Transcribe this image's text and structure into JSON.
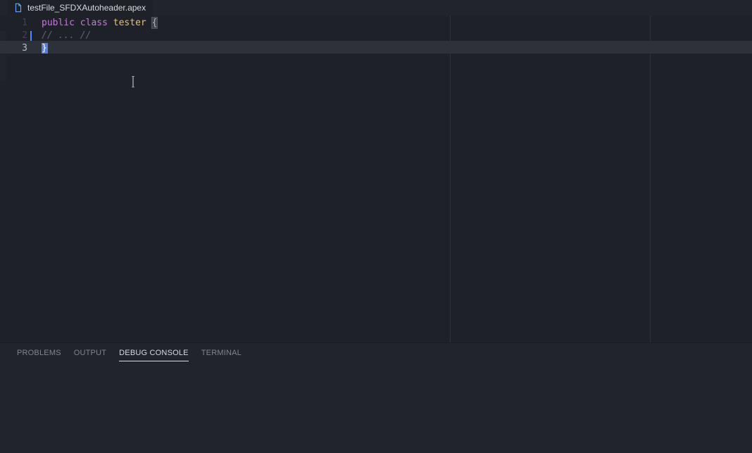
{
  "tab": {
    "filename": "testFile_SFDXAutoheader.apex"
  },
  "editor": {
    "line_numbers": [
      "1",
      "2",
      "3"
    ],
    "code": {
      "line1": {
        "kw1": "public",
        "kw2": "class",
        "ident": "tester",
        "brace_open": "{"
      },
      "line2": {
        "comment": "// ... //"
      },
      "line3": {
        "brace_close": "}"
      }
    }
  },
  "panel": {
    "tabs": {
      "problems": "PROBLEMS",
      "output": "OUTPUT",
      "debug_console": "DEBUG CONSOLE",
      "terminal": "TERMINAL"
    }
  }
}
